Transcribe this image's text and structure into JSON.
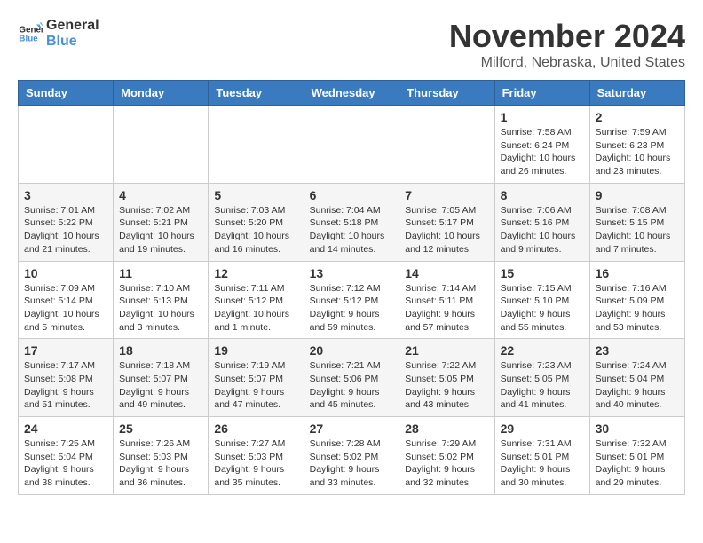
{
  "logo": {
    "general": "General",
    "blue": "Blue"
  },
  "title": "November 2024",
  "subtitle": "Milford, Nebraska, United States",
  "weekdays": [
    "Sunday",
    "Monday",
    "Tuesday",
    "Wednesday",
    "Thursday",
    "Friday",
    "Saturday"
  ],
  "weeks": [
    [
      {
        "day": "",
        "info": ""
      },
      {
        "day": "",
        "info": ""
      },
      {
        "day": "",
        "info": ""
      },
      {
        "day": "",
        "info": ""
      },
      {
        "day": "",
        "info": ""
      },
      {
        "day": "1",
        "info": "Sunrise: 7:58 AM\nSunset: 6:24 PM\nDaylight: 10 hours and 26 minutes."
      },
      {
        "day": "2",
        "info": "Sunrise: 7:59 AM\nSunset: 6:23 PM\nDaylight: 10 hours and 23 minutes."
      }
    ],
    [
      {
        "day": "3",
        "info": "Sunrise: 7:01 AM\nSunset: 5:22 PM\nDaylight: 10 hours and 21 minutes."
      },
      {
        "day": "4",
        "info": "Sunrise: 7:02 AM\nSunset: 5:21 PM\nDaylight: 10 hours and 19 minutes."
      },
      {
        "day": "5",
        "info": "Sunrise: 7:03 AM\nSunset: 5:20 PM\nDaylight: 10 hours and 16 minutes."
      },
      {
        "day": "6",
        "info": "Sunrise: 7:04 AM\nSunset: 5:18 PM\nDaylight: 10 hours and 14 minutes."
      },
      {
        "day": "7",
        "info": "Sunrise: 7:05 AM\nSunset: 5:17 PM\nDaylight: 10 hours and 12 minutes."
      },
      {
        "day": "8",
        "info": "Sunrise: 7:06 AM\nSunset: 5:16 PM\nDaylight: 10 hours and 9 minutes."
      },
      {
        "day": "9",
        "info": "Sunrise: 7:08 AM\nSunset: 5:15 PM\nDaylight: 10 hours and 7 minutes."
      }
    ],
    [
      {
        "day": "10",
        "info": "Sunrise: 7:09 AM\nSunset: 5:14 PM\nDaylight: 10 hours and 5 minutes."
      },
      {
        "day": "11",
        "info": "Sunrise: 7:10 AM\nSunset: 5:13 PM\nDaylight: 10 hours and 3 minutes."
      },
      {
        "day": "12",
        "info": "Sunrise: 7:11 AM\nSunset: 5:12 PM\nDaylight: 10 hours and 1 minute."
      },
      {
        "day": "13",
        "info": "Sunrise: 7:12 AM\nSunset: 5:12 PM\nDaylight: 9 hours and 59 minutes."
      },
      {
        "day": "14",
        "info": "Sunrise: 7:14 AM\nSunset: 5:11 PM\nDaylight: 9 hours and 57 minutes."
      },
      {
        "day": "15",
        "info": "Sunrise: 7:15 AM\nSunset: 5:10 PM\nDaylight: 9 hours and 55 minutes."
      },
      {
        "day": "16",
        "info": "Sunrise: 7:16 AM\nSunset: 5:09 PM\nDaylight: 9 hours and 53 minutes."
      }
    ],
    [
      {
        "day": "17",
        "info": "Sunrise: 7:17 AM\nSunset: 5:08 PM\nDaylight: 9 hours and 51 minutes."
      },
      {
        "day": "18",
        "info": "Sunrise: 7:18 AM\nSunset: 5:07 PM\nDaylight: 9 hours and 49 minutes."
      },
      {
        "day": "19",
        "info": "Sunrise: 7:19 AM\nSunset: 5:07 PM\nDaylight: 9 hours and 47 minutes."
      },
      {
        "day": "20",
        "info": "Sunrise: 7:21 AM\nSunset: 5:06 PM\nDaylight: 9 hours and 45 minutes."
      },
      {
        "day": "21",
        "info": "Sunrise: 7:22 AM\nSunset: 5:05 PM\nDaylight: 9 hours and 43 minutes."
      },
      {
        "day": "22",
        "info": "Sunrise: 7:23 AM\nSunset: 5:05 PM\nDaylight: 9 hours and 41 minutes."
      },
      {
        "day": "23",
        "info": "Sunrise: 7:24 AM\nSunset: 5:04 PM\nDaylight: 9 hours and 40 minutes."
      }
    ],
    [
      {
        "day": "24",
        "info": "Sunrise: 7:25 AM\nSunset: 5:04 PM\nDaylight: 9 hours and 38 minutes."
      },
      {
        "day": "25",
        "info": "Sunrise: 7:26 AM\nSunset: 5:03 PM\nDaylight: 9 hours and 36 minutes."
      },
      {
        "day": "26",
        "info": "Sunrise: 7:27 AM\nSunset: 5:03 PM\nDaylight: 9 hours and 35 minutes."
      },
      {
        "day": "27",
        "info": "Sunrise: 7:28 AM\nSunset: 5:02 PM\nDaylight: 9 hours and 33 minutes."
      },
      {
        "day": "28",
        "info": "Sunrise: 7:29 AM\nSunset: 5:02 PM\nDaylight: 9 hours and 32 minutes."
      },
      {
        "day": "29",
        "info": "Sunrise: 7:31 AM\nSunset: 5:01 PM\nDaylight: 9 hours and 30 minutes."
      },
      {
        "day": "30",
        "info": "Sunrise: 7:32 AM\nSunset: 5:01 PM\nDaylight: 9 hours and 29 minutes."
      }
    ]
  ]
}
